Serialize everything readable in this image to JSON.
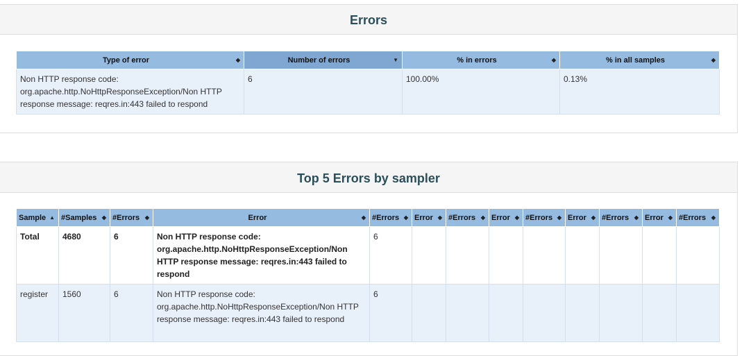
{
  "errors_panel": {
    "title": "Errors",
    "headers": [
      "Type of error",
      "Number of errors",
      "% in errors",
      "% in all samples"
    ],
    "rows": [
      {
        "type": "Non HTTP response code: org.apache.http.NoHttpResponseException/Non HTTP response message: reqres.in:443 failed to respond",
        "count": "6",
        "pct_errors": "100.00%",
        "pct_all": "0.13%"
      }
    ]
  },
  "top5_panel": {
    "title": "Top 5 Errors by sampler",
    "headers": [
      "Sample",
      "#Samples",
      "#Errors",
      "Error",
      "#Errors",
      "Error",
      "#Errors",
      "Error",
      "#Errors",
      "Error",
      "#Errors",
      "Error",
      "#Errors"
    ],
    "rows": [
      {
        "sample": "Total",
        "samples": "4680",
        "errors": "6",
        "error1": "Non HTTP response code: org.apache.http.NoHttpResponseException/Non HTTP response message: reqres.in:443 failed to respond",
        "errors1": "6"
      },
      {
        "sample": "register",
        "samples": "1560",
        "errors": "6",
        "error1": "Non HTTP response code: org.apache.http.NoHttpResponseException/Non HTTP response message: reqres.in:443 failed to respond",
        "errors1": "6"
      }
    ]
  },
  "icons": {
    "sort_both": "sort-both-icon",
    "sort_desc": "sort-desc-icon",
    "sort_asc": "sort-asc-icon"
  },
  "colors": {
    "header_bg": "#95bbe1",
    "header_sorted_bg": "#80a7d2",
    "row_bg": "#e8f0fa",
    "title_color": "#2b4f5a"
  }
}
